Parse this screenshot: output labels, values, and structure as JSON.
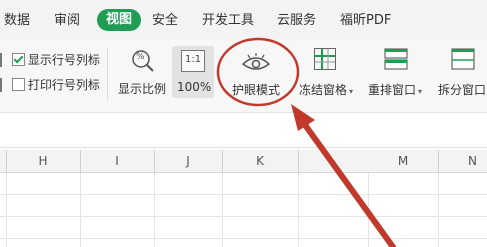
{
  "tabs": [
    "数据",
    "审阅",
    "视图",
    "安全",
    "开发工具",
    "云服务",
    "福昕PDF"
  ],
  "active_tab": "视图",
  "checkboxes": [
    {
      "label": "显示行号列标",
      "checked": true
    },
    {
      "label": "打印行号列标",
      "checked": false
    }
  ],
  "ribbon": {
    "zoom_label": "显示比例",
    "zoom_100_label": "100%",
    "zoom_100_icon_text": "1:1",
    "zoom_icon_text": "%",
    "eye_mode_label": "护眼模式",
    "freeze_label": "冻结窗格",
    "arrange_label": "重排窗口",
    "split_label": "拆分窗口"
  },
  "columns": [
    "H",
    "I",
    "J",
    "K",
    "M",
    "N"
  ],
  "colors": {
    "active_tab": "#1f9d55",
    "annotation": "#c0392b"
  },
  "icons": [
    "zoom-icon",
    "zoom-100-icon",
    "eye-icon",
    "freeze-panes-icon",
    "arrange-window-icon",
    "split-window-icon"
  ]
}
